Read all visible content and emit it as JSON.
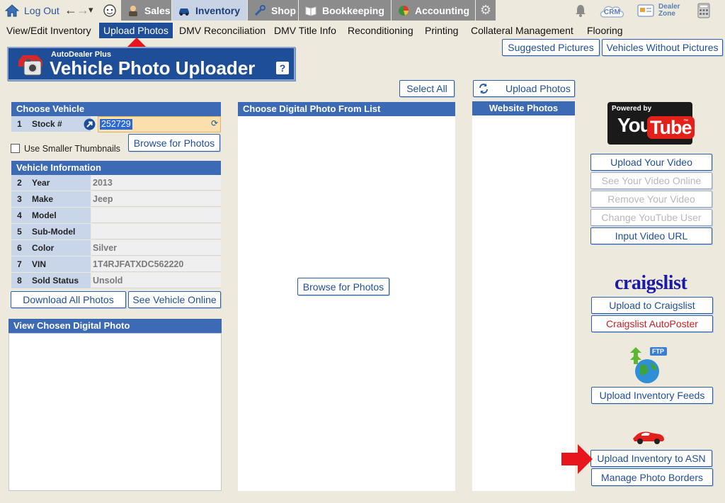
{
  "topbar": {
    "logout_label": "Log Out",
    "nav_glyphs": {
      "back": "←",
      "forward": "→",
      "dropdown": "▾"
    },
    "tabs": [
      {
        "label": "Sales",
        "icon": "salesperson-icon"
      },
      {
        "label": "Inventory",
        "icon": "car-icon"
      },
      {
        "label": "Shop",
        "icon": "wrench-icon"
      },
      {
        "label": "Bookkeeping",
        "icon": "book-icon"
      },
      {
        "label": "Accounting",
        "icon": "pie-chart-icon"
      }
    ],
    "crm_label": "CRM",
    "dealer_zone_label": "Dealer Zone"
  },
  "menu": {
    "items": [
      "View/Edit Inventory",
      "Upload Photos",
      "DMV Reconciliation",
      "DMV Title Info",
      "Reconditioning",
      "Printing",
      "Collateral Management",
      "Flooring"
    ],
    "active_index": 1
  },
  "header": {
    "brand": "AutoDealer Plus",
    "title": "Vehicle Photo Uploader",
    "help_glyph": "?"
  },
  "buttons": {
    "suggested_pictures": "Suggested Pictures",
    "vehicles_without_pictures": "Vehicles Without Pictures",
    "select_all": "Select All",
    "upload_photos": "Upload Photos",
    "browse_for_photos": "Browse for Photos",
    "browse_for_photos_center": "Browse for Photos",
    "download_all_photos": "Download All Photos",
    "see_vehicle_online": "See Vehicle Online"
  },
  "choose_vehicle": {
    "title": "Choose Vehicle",
    "row_number": "1",
    "stock_label": "Stock #",
    "stock_value": "252729",
    "smaller_thumbnails_label": "Use Smaller Thumbnails"
  },
  "vehicle_info": {
    "title": "Vehicle Information",
    "rows": [
      {
        "num": "2",
        "label": "Year",
        "value": "2013"
      },
      {
        "num": "3",
        "label": "Make",
        "value": "Jeep"
      },
      {
        "num": "4",
        "label": "Model",
        "value": ""
      },
      {
        "num": "5",
        "label": "Sub-Model",
        "value": ""
      },
      {
        "num": "6",
        "label": "Color",
        "value": "Silver"
      },
      {
        "num": "7",
        "label": "VIN",
        "value": "1T4RJFATXDC562220"
      },
      {
        "num": "8",
        "label": "Sold Status",
        "value": "Unsold"
      }
    ]
  },
  "panels": {
    "view_chosen": "View Chosen Digital Photo",
    "choose_from_list": "Choose Digital Photo From List",
    "website_photos": "Website Photos"
  },
  "youtube": {
    "powered_by": "Powered by",
    "logo_you": "You",
    "logo_tube": "Tube",
    "tm": "™",
    "buttons": [
      {
        "label": "Upload Your Video",
        "enabled": true
      },
      {
        "label": "See Your Video Online",
        "enabled": false
      },
      {
        "label": "Remove Your Video",
        "enabled": false
      },
      {
        "label": "Change YouTube User",
        "enabled": false
      },
      {
        "label": "Input Video URL",
        "enabled": true
      }
    ]
  },
  "craigslist": {
    "logo_text": "craigslist",
    "upload_label": "Upload to Craigslist",
    "autoposter_label": "Craigslist AutoPoster"
  },
  "feeds": {
    "ftp_label": "FTP",
    "upload_feeds_label": "Upload Inventory Feeds"
  },
  "asn": {
    "upload_asn_label": "Upload Inventory to ASN",
    "manage_borders_label": "Manage Photo Borders"
  },
  "colors": {
    "accent": "#1f4e98",
    "panel_header": "#3c6ab4",
    "background": "#ede9dc",
    "highlight_arrow": "#e8161c"
  }
}
